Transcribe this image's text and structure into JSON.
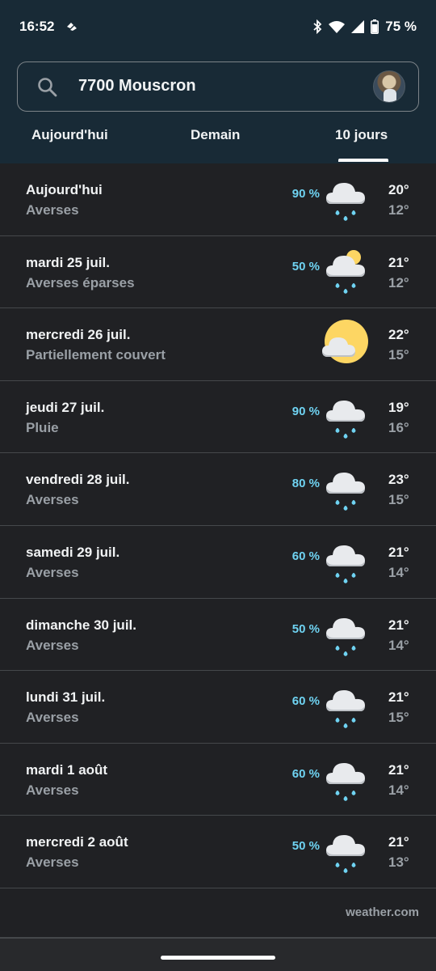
{
  "status_bar": {
    "time": "16:52",
    "battery": "75 %",
    "icons": [
      "notification-icon",
      "bluetooth-icon",
      "wifi-icon",
      "signal-icon",
      "battery-icon"
    ]
  },
  "search": {
    "location": "7700 Mouscron",
    "icon": "search-icon"
  },
  "tabs": [
    {
      "label": "Aujourd'hui"
    },
    {
      "label": "Demain"
    },
    {
      "label": "10 jours",
      "selected": true
    }
  ],
  "days": [
    {
      "day": "Aujourd'hui",
      "condition": "Averses",
      "precip": "90 %",
      "icon": "showers",
      "high": "20°",
      "low": "12°"
    },
    {
      "day": "mardi 25 juil.",
      "condition": "Averses éparses",
      "precip": "50 %",
      "icon": "scattered-showers",
      "high": "21°",
      "low": "12°"
    },
    {
      "day": "mercredi 26 juil.",
      "condition": "Partiellement couvert",
      "precip": "",
      "icon": "partly-cloudy",
      "high": "22°",
      "low": "15°"
    },
    {
      "day": "jeudi 27 juil.",
      "condition": "Pluie",
      "precip": "90 %",
      "icon": "showers",
      "high": "19°",
      "low": "16°"
    },
    {
      "day": "vendredi 28 juil.",
      "condition": "Averses",
      "precip": "80 %",
      "icon": "showers",
      "high": "23°",
      "low": "15°"
    },
    {
      "day": "samedi 29 juil.",
      "condition": "Averses",
      "precip": "60 %",
      "icon": "showers",
      "high": "21°",
      "low": "14°"
    },
    {
      "day": "dimanche 30 juil.",
      "condition": "Averses",
      "precip": "50 %",
      "icon": "showers",
      "high": "21°",
      "low": "14°"
    },
    {
      "day": "lundi 31 juil.",
      "condition": "Averses",
      "precip": "60 %",
      "icon": "showers",
      "high": "21°",
      "low": "15°"
    },
    {
      "day": "mardi 1 août",
      "condition": "Averses",
      "precip": "60 %",
      "icon": "showers",
      "high": "21°",
      "low": "14°"
    },
    {
      "day": "mercredi 2 août",
      "condition": "Averses",
      "precip": "50 %",
      "icon": "showers",
      "high": "21°",
      "low": "13°"
    }
  ],
  "source": "weather.com",
  "colors": {
    "header_bg": "#182a36",
    "body_bg": "#202124",
    "precip": "#6fd3f2",
    "sun": "#fdd663",
    "cloud": "#e8eaed"
  }
}
